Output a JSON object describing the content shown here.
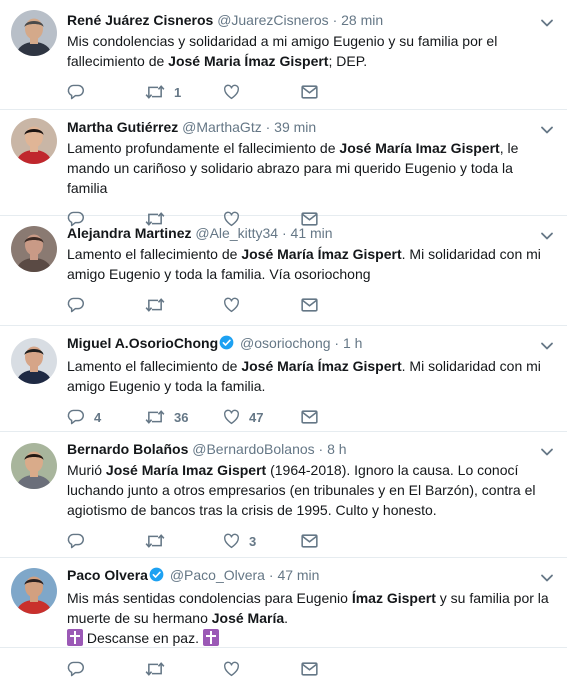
{
  "tweets": [
    {
      "name": "René Juárez Cisneros",
      "handle": "@JuarezCisneros",
      "separator": "·",
      "time": "28 min",
      "verified": false,
      "text_html": "Mis condolencias y solidaridad a mi amigo Eugenio y su familia por el fallecimiento de <b>José Maria Ímaz Gispert</b>; DEP.",
      "counts": {
        "reply": "",
        "retweet": "1",
        "like": ""
      }
    },
    {
      "name": "Martha Gutiérrez",
      "handle": "@MarthaGtz",
      "separator": "·",
      "time": "39 min",
      "verified": false,
      "text_html": "Lamento profundamente el fallecimiento de <b>José María Imaz Gispert</b>, le mando un cariñoso y solidario abrazo para mi querido Eugenio y toda la familia",
      "counts": {
        "reply": "",
        "retweet": "",
        "like": ""
      }
    },
    {
      "name": "Alejandra Martinez",
      "handle": "@Ale_kitty34",
      "separator": "·",
      "time": "41 min",
      "verified": false,
      "text_html": "Lamento el fallecimiento de <b>José María Ímaz Gispert</b>. Mi solidaridad con mi amigo Eugenio y toda la familia. Vía osoriochong",
      "counts": {
        "reply": "",
        "retweet": "",
        "like": ""
      }
    },
    {
      "name": "Miguel A.OsorioChong",
      "handle": "@osoriochong",
      "separator": "·",
      "time": "1 h",
      "verified": true,
      "text_html": "Lamento el fallecimiento de <b>José María Ímaz Gispert</b>. Mi solidaridad con mi amigo Eugenio y toda la familia.",
      "counts": {
        "reply": "4",
        "retweet": "36",
        "like": "47"
      }
    },
    {
      "name": "Bernardo Bolaños",
      "handle": "@BernardoBolanos",
      "separator": "·",
      "time": "8 h",
      "verified": false,
      "text_html": "Murió <b>José María Imaz Gispert</b> (1964-2018). Ignoro la causa. Lo conocí luchando junto a otros empresarios (en tribunales  y en El Barzón), contra el agiotismo de bancos tras la crisis de 1995. Culto y honesto.",
      "counts": {
        "reply": "",
        "retweet": "",
        "like": "3"
      }
    },
    {
      "name": "Paco Olvera",
      "handle": "@Paco_Olvera",
      "separator": "·",
      "time": "47 min",
      "verified": true,
      "text_html": "Mis más sentidas condolencias para Eugenio <b>Ímaz Gispert</b> y su familia por la muerte de su hermano <b>José María</b>.<br><span class=\"cross-emoji\" data-name=\"latin-cross-emoji-icon\" data-interactable=\"false\"></span> Descanse en paz. <span class=\"cross-emoji\" data-name=\"latin-cross-emoji-icon\" data-interactable=\"false\"></span>",
      "counts": {
        "reply": "",
        "retweet": "",
        "like": ""
      }
    }
  ],
  "icons": {
    "reply": "reply-icon",
    "retweet": "retweet-icon",
    "like": "like-heart-icon",
    "dm": "direct-message-icon",
    "caret": "chevron-down-icon",
    "verified": "verified-badge-icon"
  },
  "colors": {
    "icon_gray": "#657786",
    "name_text": "#14171a",
    "divider": "#e6ecf0",
    "verified_blue": "#1da1f2"
  }
}
